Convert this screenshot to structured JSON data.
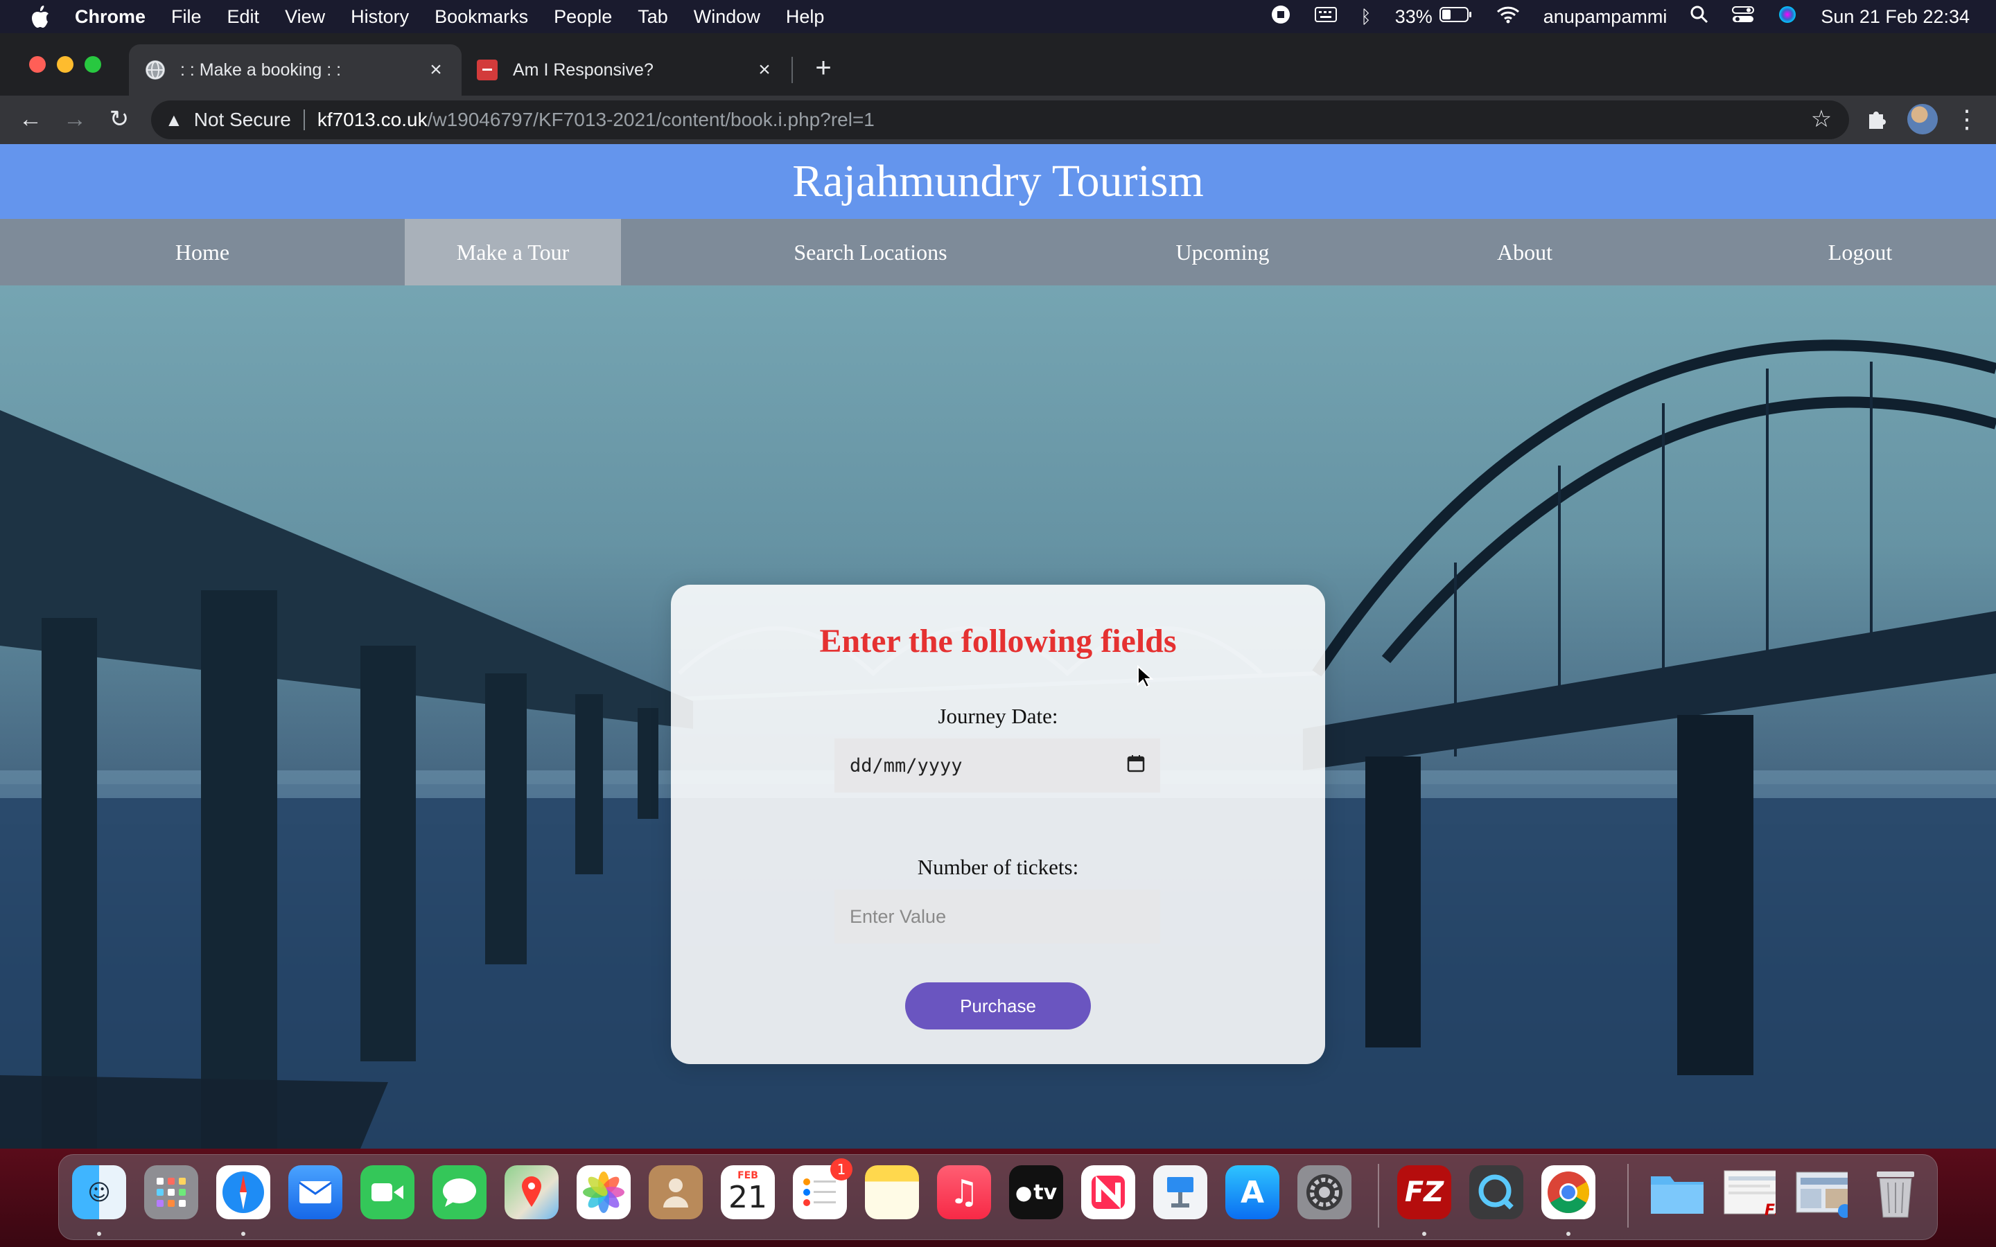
{
  "menubar": {
    "app": "Chrome",
    "items": [
      "File",
      "Edit",
      "View",
      "History",
      "Bookmarks",
      "People",
      "Tab",
      "Window",
      "Help"
    ],
    "battery": "33%",
    "user": "anupampammi",
    "datetime": "Sun 21 Feb  22:34"
  },
  "browser": {
    "tabs": [
      {
        "title": ": : Make a booking : :",
        "active": true
      },
      {
        "title": "Am I Responsive?",
        "active": false
      }
    ],
    "security_label": "Not Secure",
    "url_host": "kf7013.co.uk",
    "url_path": "/w19046797/KF7013-2021/content/book.i.php?rel=1"
  },
  "site": {
    "title": "Rajahmundry Tourism",
    "nav": [
      {
        "label": "Home",
        "active": false
      },
      {
        "label": "Make a Tour",
        "active": true
      },
      {
        "label": "Search Locations",
        "active": false
      },
      {
        "label": "Upcoming",
        "active": false
      },
      {
        "label": "About",
        "active": false
      },
      {
        "label": "Logout",
        "active": false
      }
    ]
  },
  "form": {
    "title": "Enter the following fields",
    "date_label": "Journey Date:",
    "date_value": "dd/mm/yyyy",
    "tickets_label": "Number of tickets:",
    "tickets_placeholder": "Enter Value",
    "submit_label": "Purchase"
  },
  "dock": {
    "apps": [
      "Finder",
      "Launchpad",
      "Safari",
      "Mail",
      "FaceTime",
      "Messages",
      "Maps",
      "Photos",
      "Contacts",
      "Calendar",
      "Reminders",
      "Notes",
      "Music",
      "TV",
      "News",
      "Keynote",
      "App Store",
      "System Preferences",
      "FileZilla",
      "QuickTime Player",
      "Google Chrome",
      "Downloads",
      "Stack",
      "Stack",
      "Trash"
    ],
    "calendar_month": "FEB",
    "calendar_day": "21",
    "reminders_badge": "1",
    "tv_label": "tv",
    "filezilla_label": "FZ"
  },
  "colors": {
    "site_header": "#6495ed",
    "nav_bar": "#7e8b99",
    "nav_active": "#a9b1ba",
    "form_title": "#e53131",
    "purchase_button": "#6a55c0"
  }
}
